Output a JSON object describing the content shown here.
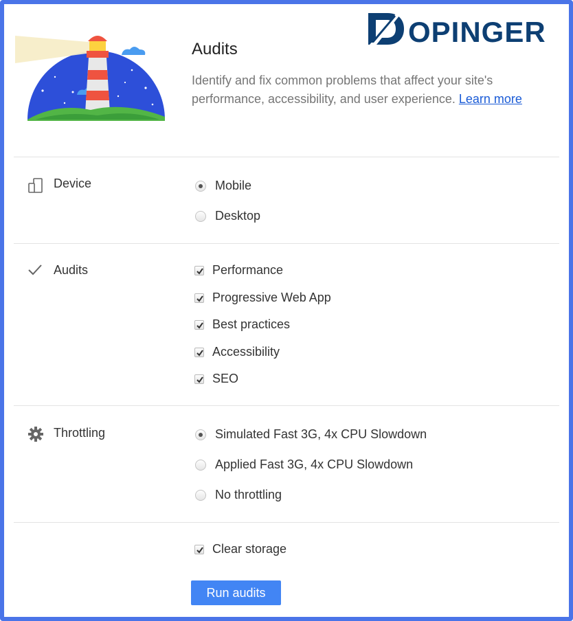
{
  "brand": {
    "name": "DOPINGER",
    "color": "#0d3f73"
  },
  "header": {
    "title": "Audits",
    "description": "Identify and fix common problems that affect your site's performance, accessibility, and user experience.",
    "learn_more": "Learn more"
  },
  "device": {
    "label": "Device",
    "icon": "device-icon",
    "options": [
      {
        "label": "Mobile",
        "checked": true
      },
      {
        "label": "Desktop",
        "checked": false
      }
    ]
  },
  "audits": {
    "label": "Audits",
    "icon": "checkmark-icon",
    "options": [
      {
        "label": "Performance",
        "checked": true
      },
      {
        "label": "Progressive Web App",
        "checked": true
      },
      {
        "label": "Best practices",
        "checked": true
      },
      {
        "label": "Accessibility",
        "checked": true
      },
      {
        "label": "SEO",
        "checked": true
      }
    ]
  },
  "throttling": {
    "label": "Throttling",
    "icon": "gear-icon",
    "options": [
      {
        "label": "Simulated Fast 3G, 4x CPU Slowdown",
        "checked": true
      },
      {
        "label": "Applied Fast 3G, 4x CPU Slowdown",
        "checked": false
      },
      {
        "label": "No throttling",
        "checked": false
      }
    ]
  },
  "clear_storage": {
    "label": "Clear storage",
    "checked": true
  },
  "run_button": {
    "label": "Run audits",
    "color": "#4285f4"
  },
  "frame_color": "#4a74e8"
}
